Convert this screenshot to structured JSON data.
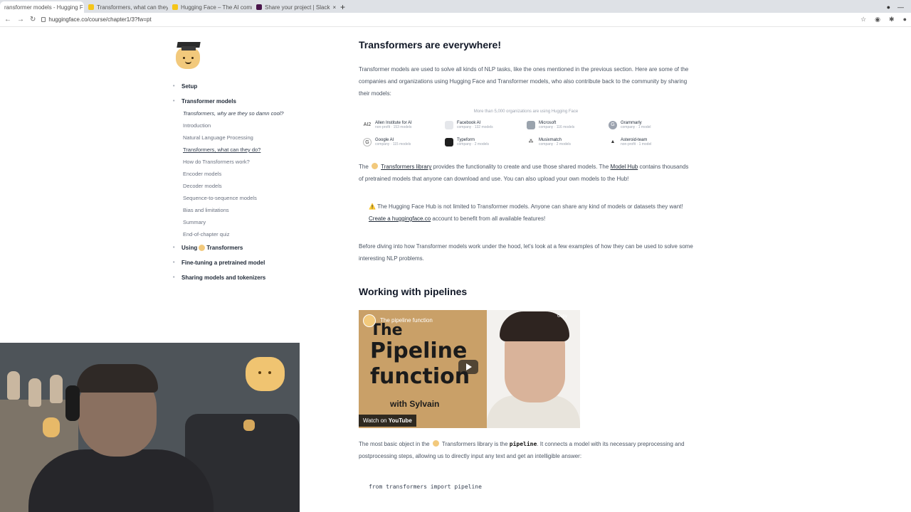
{
  "browser": {
    "tabs": [
      {
        "label": "ransformer models - Hugging F",
        "active": true
      },
      {
        "label": "Transformers, what can they do"
      },
      {
        "label": "Hugging Face – The AI commu"
      },
      {
        "label": "Share your project | Slack"
      }
    ],
    "url": "huggingface.co/course/chapter1/3?fw=pt"
  },
  "sidebar": {
    "sections": [
      {
        "label": "Setup"
      },
      {
        "label": "Transformer models",
        "items": [
          "Transformers, why are they so damn cool?",
          "Introduction",
          "Natural Language Processing",
          "Transformers, what can they do?",
          "How do Transformers work?",
          "Encoder models",
          "Decoder models",
          "Sequence-to-sequence models",
          "Bias and limitations",
          "Summary",
          "End-of-chapter quiz"
        ]
      },
      {
        "label_prefix": "Using",
        "label_suffix": "Transformers"
      },
      {
        "label": "Fine-tuning a pretrained model"
      },
      {
        "label": "Sharing models and tokenizers"
      }
    ]
  },
  "main": {
    "heading1": "Transformers are everywhere!",
    "para1": "Transformer models are used to solve all kinds of NLP tasks, like the ones mentioned in the previous section. Here are some of the companies and organizations using Hugging Face and Transformer models, who also contribute back to the community by sharing their models:",
    "orgs_caption": "More than 5,000 organizations are using Hugging Face",
    "orgs": [
      {
        "name": "Allen Institute for AI",
        "meta": "non-profit · 153 models",
        "icon": "AI2",
        "color": "#ffffff"
      },
      {
        "name": "Facebook AI",
        "meta": "company · 132 models",
        "icon": "facebook-icon",
        "color": "#e5e7eb"
      },
      {
        "name": "Microsoft",
        "meta": "company · 116 models",
        "icon": "microsoft-icon",
        "color": "#9aa3ad"
      },
      {
        "name": "Grammarly",
        "meta": "company · 1 model",
        "icon": "G",
        "color": "#9ca3af"
      },
      {
        "name": "Google AI",
        "meta": "company · 115 models",
        "icon": "G",
        "color": "#ffffff"
      },
      {
        "name": "Typeform",
        "meta": "company · 2 models",
        "icon": "typeform-icon",
        "color": "#1f1f1f"
      },
      {
        "name": "Musixmatch",
        "meta": "company · 2 models",
        "icon": "musixmatch-icon",
        "color": "#ffffff"
      },
      {
        "name": "Asteroid-team",
        "meta": "non-profit · 1 model",
        "icon": "asteroid-icon",
        "color": "#ffffff"
      }
    ],
    "para2_a": "The",
    "para2_link1": "Transformers library",
    "para2_b": "provides the functionality to create and use those shared models. The",
    "para2_link2": "Model Hub",
    "para2_c": "contains thousands of pretrained models that anyone can download and use. You can also upload your own models to the Hub!",
    "note_a": "The Hugging Face Hub is not limited to Transformer models. Anyone can share any kind of models or datasets they want!",
    "note_link": "Create a huggingface.co",
    "note_b": "account to benefit from all available features!",
    "para3": "Before diving into how Transformer models work under the hood, let's look at a few examples of how they can be used to solve some interesting NLP problems.",
    "heading2": "Working with pipelines",
    "video": {
      "title": "The pipeline function",
      "line1": "The",
      "line2": "Pipeline",
      "line3": "function",
      "with": "with Sylvain",
      "watch": "Watch on",
      "youtube": "YouTube",
      "copy": "Copy"
    },
    "para4_a": "The most basic object in the",
    "para4_b": "Transformers library is the",
    "para4_code": "pipeline",
    "para4_c": ". It connects a model with its necessary preprocessing and postprocessing steps, allowing us to directly input any text and get an intelligible answer:",
    "code_line": "from transformers import pipeline"
  }
}
